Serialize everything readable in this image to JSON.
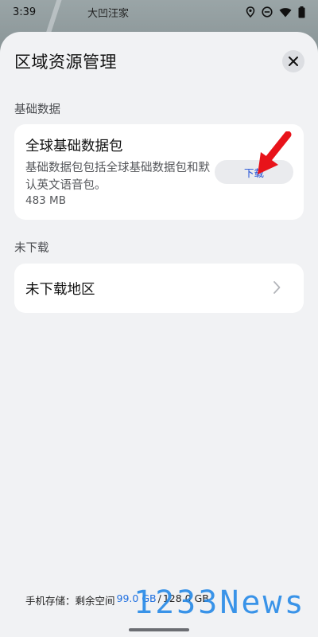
{
  "status_bar": {
    "time": "3:39",
    "icons": [
      "location-icon",
      "do-not-disturb-icon",
      "wifi-icon",
      "battery-icon"
    ]
  },
  "map": {
    "label": "大凹汪家"
  },
  "sheet": {
    "title": "区域资源管理",
    "close_icon": "close-icon"
  },
  "basic_data": {
    "section_label": "基础数据",
    "package_title": "全球基础数据包",
    "package_description": "基础数据包包括全球基础数据包和默认英文语音包。",
    "package_size": "483 MB",
    "download_label": "下载"
  },
  "not_downloaded": {
    "section_label": "未下载",
    "row_label": "未下载地区"
  },
  "storage": {
    "prefix": "手机存储：剩余空间",
    "free": "99.0 GB",
    "separator": "/",
    "total": "128.0 GB"
  },
  "watermark": {
    "text": "1233News"
  },
  "colors": {
    "accent": "#1f4fd6",
    "annotation_arrow": "#e8131a",
    "sheet_bg": "#f1f2f4",
    "card_bg": "#ffffff"
  }
}
